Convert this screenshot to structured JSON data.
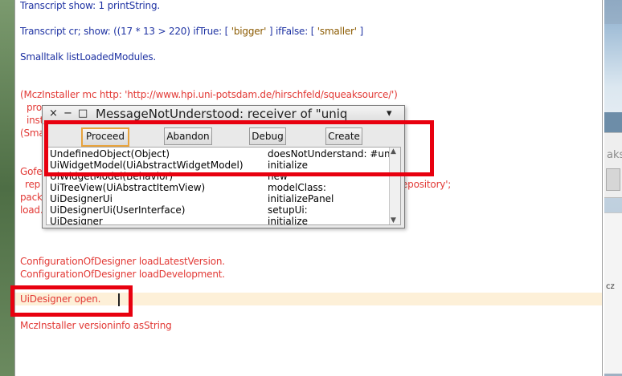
{
  "workspace": {
    "lines": {
      "l1": "Transcript show: 1 printString.",
      "l2a": "Transcript",
      "l2b": " cr; show: ((17 * 13 > 220)  ifTrue: [ ",
      "l2c": "'bigger'",
      "l2d": " ]  ifFalse: [ ",
      "l2e": "'smaller'",
      "l2f": " ]",
      "l3": "Smalltalk listLoadedModules.",
      "l4": "(MczInstaller mc http: 'http://www.hpi.uni-potsdam.de/hirschfeld/squeaksource/')",
      "l5": "pro",
      "l6": "inst",
      "l7": "(Sma",
      "l8": "Gofe",
      "l9a": "rep",
      "l9b": "epository';",
      "l10": "packa",
      "l11": "load.",
      "l12": "ConfigurationOfDesigner loadLatestVersion.",
      "l13": "ConfigurationOfDesigner loadDevelopment.",
      "l14": "UiDesigner open.",
      "l15": "MczInstaller versioninfo asString"
    }
  },
  "notifier": {
    "title": "MessageNotUnderstood: receiver of \"uniq",
    "icons": {
      "close": "×",
      "minimize": "−",
      "maximize": "□",
      "menu": "▾"
    },
    "buttons": {
      "proceed": "Proceed",
      "abandon": "Abandon",
      "debug": "Debug",
      "create": "Create"
    },
    "stack": [
      {
        "cls": "UndefinedObject(Object)",
        "sel": "doesNotUnderstand: #uniqu"
      },
      {
        "cls": "UiWidgetModel(UiAbstractWidgetModel)",
        "sel": "initialize"
      },
      {
        "cls": "UiWidgetModel(Behavior)",
        "sel": "new"
      },
      {
        "cls": "UiTreeView(UiAbstractItemView)",
        "sel": "modelClass:"
      },
      {
        "cls": "UiDesignerUi",
        "sel": "initializePanel"
      },
      {
        "cls": "UiDesignerUi(UserInterface)",
        "sel": "setupUi:"
      },
      {
        "cls": "UiDesigner",
        "sel": "initialize"
      }
    ]
  },
  "background": {
    "fragment1": "aks",
    "fragment2": "cz"
  },
  "colors": {
    "annotation": "#e8000f",
    "code_red": "#e23a36",
    "code_blue": "#1f33a3",
    "highlight": "#fdf0d8"
  }
}
